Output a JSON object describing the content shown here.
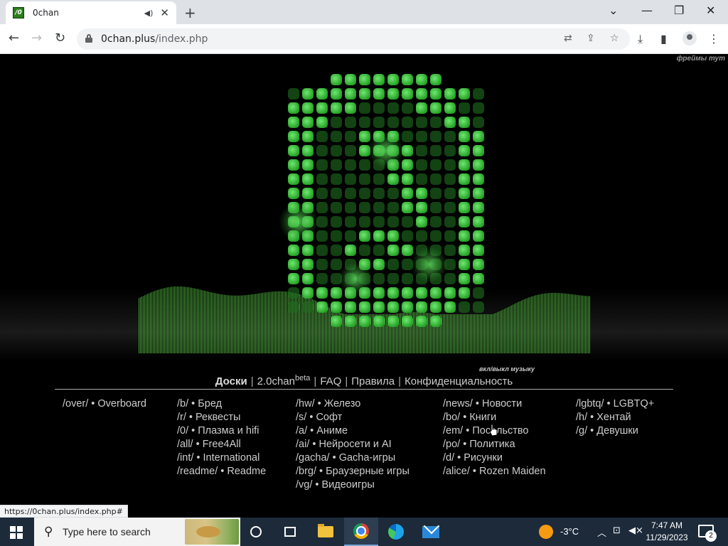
{
  "browser": {
    "tab_title": "0chan",
    "favicon_text": "/0",
    "url_host": "0chan.plus",
    "url_path": "/index.php",
    "status_url": "https://0chan.plus/index.php#"
  },
  "page": {
    "frames_link": "фреймы тут",
    "music_toggle": "вкл/выкл музыку",
    "menu": [
      {
        "label": "Доски",
        "active": true
      },
      {
        "label": "2.0chan",
        "sup": "beta"
      },
      {
        "label": "FAQ"
      },
      {
        "label": "Правила"
      },
      {
        "label": "Конфиденциальность"
      }
    ],
    "board_columns": [
      [
        "/over/ • Overboard"
      ],
      [
        "/b/ • Бред",
        "/r/ • Реквесты",
        "/0/ • Плазма и hifi",
        "/all/ • Free4All",
        "/int/ • International",
        "/readme/ • Readme"
      ],
      [
        "/hw/ • Железо",
        "/s/ • Софт",
        "/a/ • Аниме",
        "/ai/ • Нейросети и AI",
        "/gacha/ • Gacha-игры",
        "/brg/ • Браузерные игры",
        "/vg/ • Видеоигры"
      ],
      [
        "/news/ • Новости",
        "/bo/ • Книги",
        "/em/ • Посольство",
        "/po/ • Политика",
        "/d/ • Рисунки",
        "/alice/ • Rozen Maiden"
      ],
      [
        "/lgbtq/ • LGBTQ+",
        "/h/ • Хентай",
        "/g/ • Девушки"
      ]
    ],
    "logo_color": "#3ecf3e",
    "visualizer_color": "#4fb53c"
  },
  "taskbar": {
    "search_placeholder": "Type here to search",
    "temperature": "-3°C",
    "time": "7:47 AM",
    "date": "11/29/2023",
    "notification_count": "2"
  }
}
